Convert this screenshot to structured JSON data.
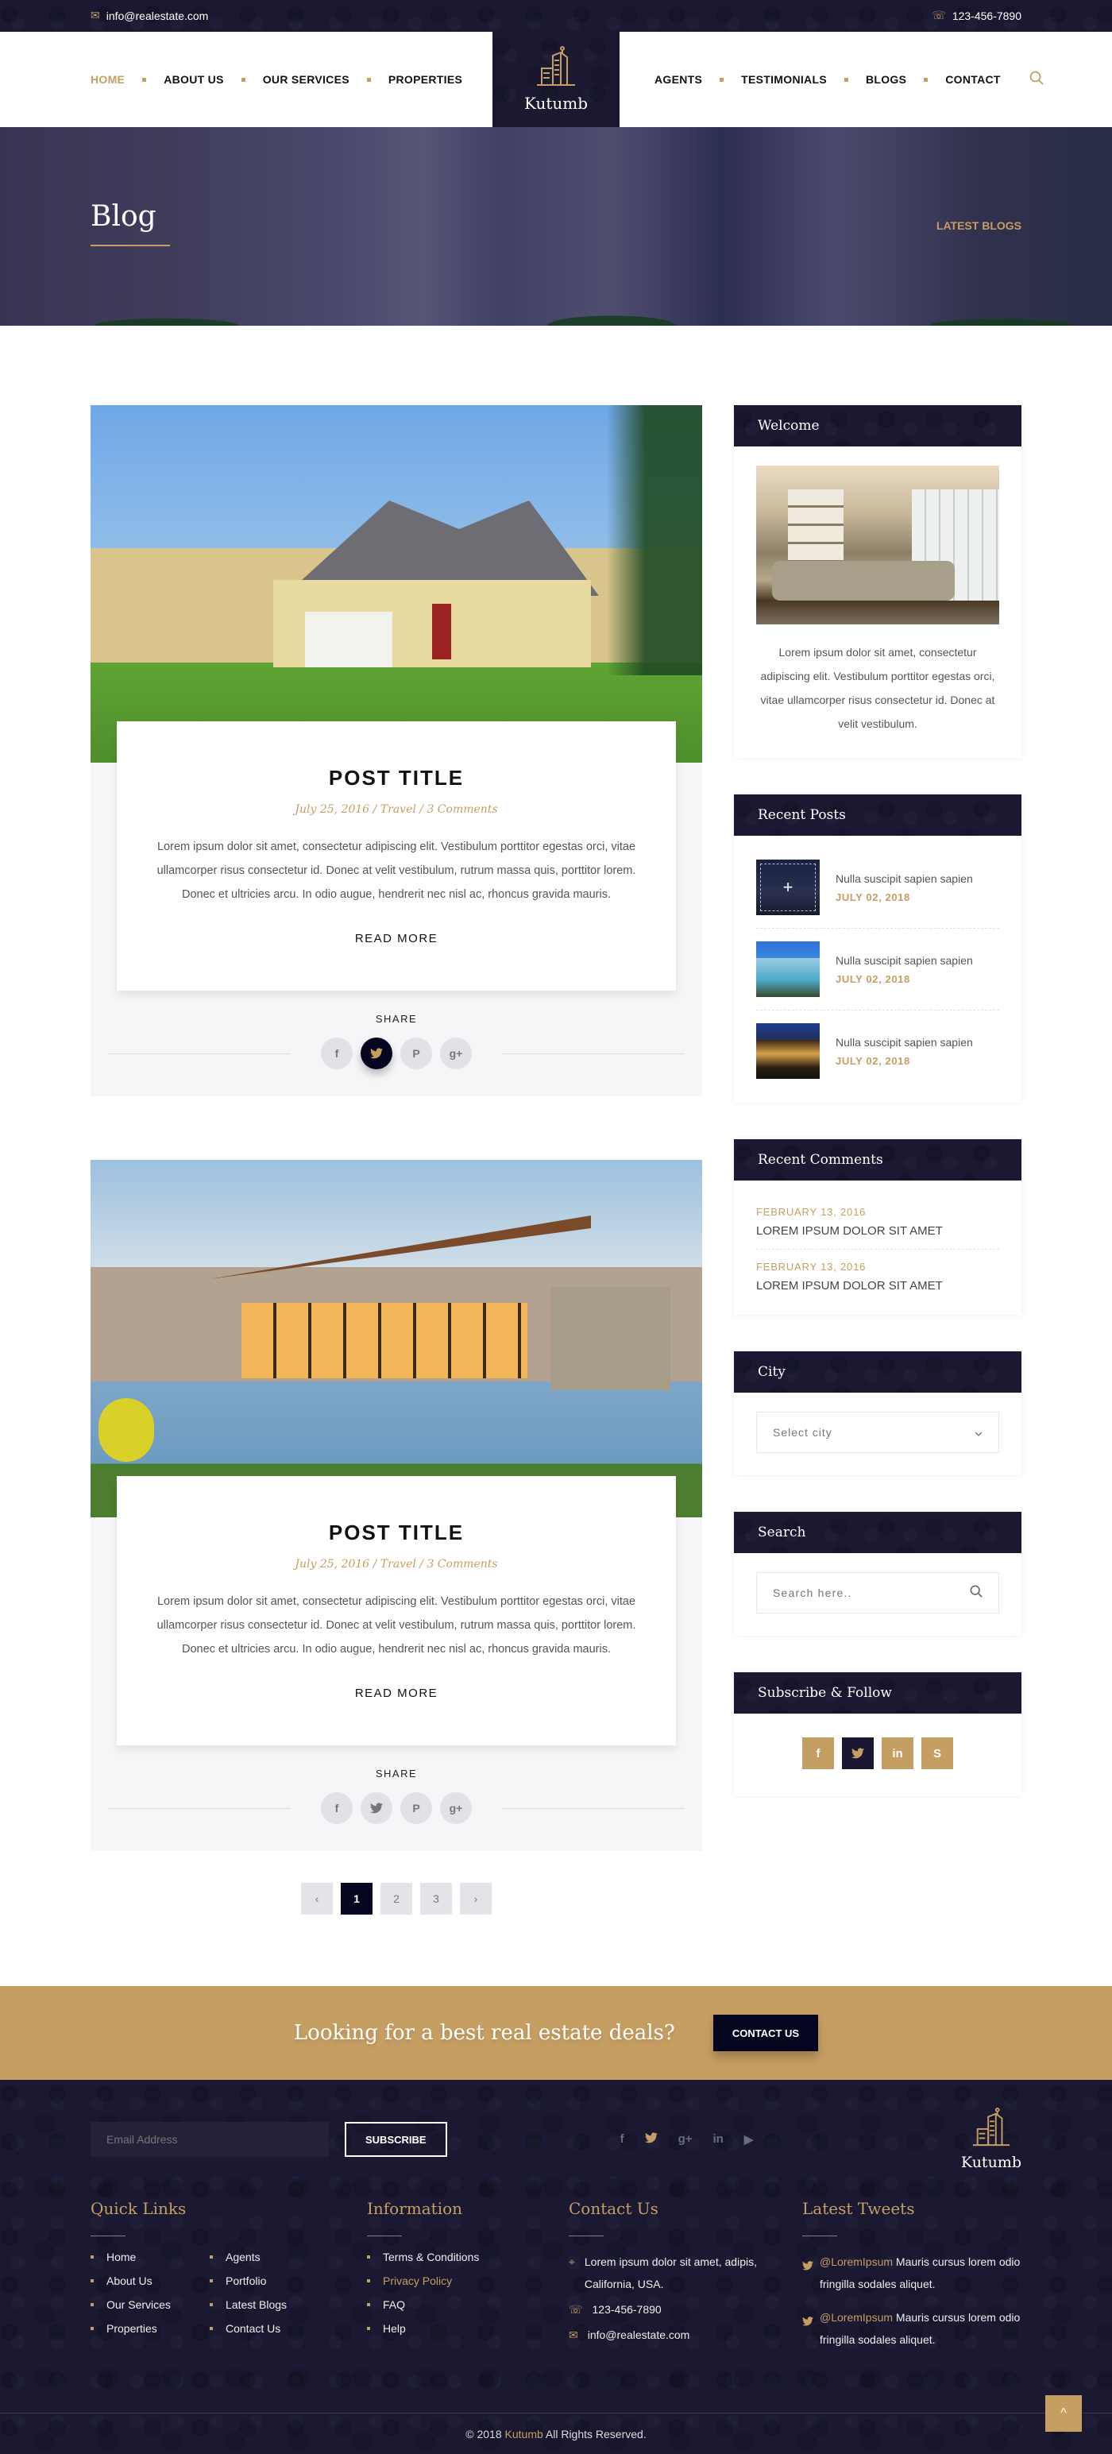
{
  "topbar": {
    "email": "info@realestate.com",
    "phone": "123-456-7890",
    "email_icon": "envelope-icon",
    "phone_icon": "phone-icon"
  },
  "nav": {
    "left": [
      {
        "label": "HOME",
        "active": true
      },
      {
        "label": "ABOUT US"
      },
      {
        "label": "OUR SERVICES"
      },
      {
        "label": "PROPERTIES"
      }
    ],
    "right": [
      {
        "label": "AGENTS"
      },
      {
        "label": "TESTIMONIALS"
      },
      {
        "label": "BLOGS"
      },
      {
        "label": "CONTACT"
      }
    ],
    "search_icon": "search-icon"
  },
  "brand": {
    "name": "Kutumb",
    "logo_icon": "building-icon"
  },
  "banner": {
    "title": "Blog",
    "breadcrumb": "LATEST BLOGS"
  },
  "posts": [
    {
      "title": "POST TITLE",
      "meta": "July 25, 2016 / Travel / 3 Comments",
      "excerpt": "Lorem ipsum dolor sit amet, consectetur adipiscing elit. Vestibulum porttitor egestas orci, vitae ullamcorper risus consectetur id. Donec at velit vestibulum, rutrum massa quis, porttitor lorem. Donec et ultricies arcu. In odio augue, hendrerit nec nisl ac, rhoncus gravida mauris.",
      "read_more": "READ MORE",
      "share_label": "SHARE",
      "share_active": "twitter"
    },
    {
      "title": "POST TITLE",
      "meta": "July 25, 2016 / Travel / 3 Comments",
      "excerpt": "Lorem ipsum dolor sit amet, consectetur adipiscing elit. Vestibulum porttitor egestas orci, vitae ullamcorper risus consectetur id. Donec at velit vestibulum, rutrum massa quis, porttitor lorem. Donec et ultricies arcu. In odio augue, hendrerit nec nisl ac, rhoncus gravida mauris.",
      "read_more": "READ MORE",
      "share_label": "SHARE",
      "share_active": null
    }
  ],
  "share_icons": [
    {
      "name": "facebook",
      "glyph": "f"
    },
    {
      "name": "twitter",
      "glyph": "t"
    },
    {
      "name": "pinterest",
      "glyph": "P"
    },
    {
      "name": "google-plus",
      "glyph": "g+"
    }
  ],
  "pagination": {
    "prev": "‹",
    "pages": [
      "1",
      "2",
      "3"
    ],
    "current": "1",
    "next": "›"
  },
  "sidebar": {
    "welcome": {
      "title": "Welcome",
      "text": "Lorem ipsum dolor sit amet, consectetur adipiscing elit. Vestibulum porttitor egestas orci, vitae ullamcorper risus consectetur id. Donec at velit vestibulum."
    },
    "recent_posts": {
      "title": "Recent Posts",
      "items": [
        {
          "title": "Nulla suscipit sapien sapien",
          "date": "JULY 02, 2018"
        },
        {
          "title": "Nulla suscipit sapien sapien",
          "date": "JULY 02, 2018"
        },
        {
          "title": "Nulla suscipit sapien sapien",
          "date": "JULY 02, 2018"
        }
      ]
    },
    "recent_comments": {
      "title": "Recent Comments",
      "items": [
        {
          "date": "FEBRUARY 13, 2016",
          "text": "LOREM IPSUM DOLOR SIT AMET"
        },
        {
          "date": "FEBRUARY 13, 2016",
          "text": "LOREM IPSUM DOLOR SIT AMET"
        }
      ]
    },
    "city": {
      "title": "City",
      "selected": "Select city"
    },
    "search": {
      "title": "Search",
      "placeholder": "Search here.."
    },
    "follow": {
      "title": "Subscribe & Follow",
      "icons": [
        {
          "name": "facebook",
          "glyph": "f"
        },
        {
          "name": "twitter",
          "glyph": "t",
          "active": true
        },
        {
          "name": "linkedin",
          "glyph": "in"
        },
        {
          "name": "skype",
          "glyph": "S"
        }
      ]
    }
  },
  "cta": {
    "text": "Looking for a best real estate deals?",
    "button": "CONTACT US"
  },
  "footer": {
    "email_placeholder": "Email Address",
    "subscribe": "SUBSCRIBE",
    "social": [
      {
        "name": "facebook",
        "glyph": "f"
      },
      {
        "name": "twitter",
        "glyph": "t",
        "active": true
      },
      {
        "name": "google-plus",
        "glyph": "g+"
      },
      {
        "name": "linkedin",
        "glyph": "in"
      },
      {
        "name": "youtube",
        "glyph": "▶"
      }
    ],
    "quick_links": {
      "title": "Quick Links",
      "col1": [
        "Home",
        "About Us",
        "Our Services",
        "Properties"
      ],
      "col2": [
        "Agents",
        "Portfolio",
        "Latest Blogs",
        "Contact Us"
      ]
    },
    "information": {
      "title": "Information",
      "items": [
        "Terms & Conditions",
        "Privacy Policy",
        "FAQ",
        "Help"
      ],
      "highlighted": "Privacy Policy"
    },
    "contact": {
      "title": "Contact Us",
      "address": "Lorem ipsum dolor sit amet, adipis, California, USA.",
      "phone": "123-456-7890",
      "email": "info@realestate.com"
    },
    "tweets": {
      "title": "Latest Tweets",
      "items": [
        {
          "handle": "@LoremIpsum",
          "text": " Mauris cursus lorem odio fringilla sodales aliquet."
        },
        {
          "handle": "@LoremIpsum",
          "text": " Mauris cursus lorem odio fringilla sodales aliquet."
        }
      ]
    },
    "copyright_prefix": "© 2018 ",
    "copyright_brand": "Kutumb",
    "copyright_suffix": " All Rights Reserved.",
    "to_top": "^"
  },
  "colors": {
    "accent_gold": "#c59e62",
    "navy": "#1a1830",
    "dark_button": "#050520"
  }
}
